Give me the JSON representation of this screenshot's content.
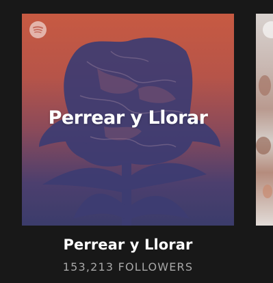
{
  "playlist": {
    "cover_title": "Perrear y Llorar",
    "name": "Perrear y Llorar",
    "followers": "153,213 FOLLOWERS"
  },
  "icons": {
    "brand": "spotify-logo-icon",
    "artwork": "rose-image"
  },
  "colors": {
    "background": "#181818",
    "cover_top": "#c75a42",
    "cover_bottom": "#3b3c6b",
    "followers_text": "#a8a8a8"
  }
}
